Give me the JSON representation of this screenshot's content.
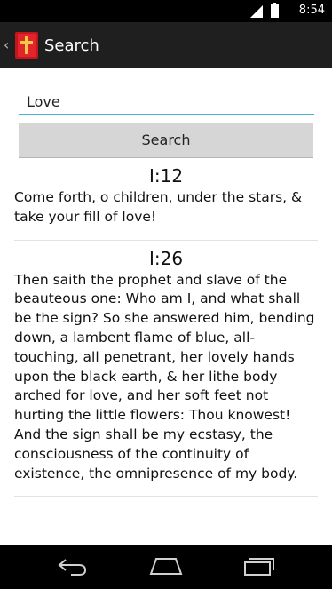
{
  "status_bar": {
    "network": "3G",
    "time": "8:54"
  },
  "action_bar": {
    "title": "Search",
    "icon": "red-book-app-icon"
  },
  "search": {
    "value": "Love",
    "button_label": "Search"
  },
  "results": [
    {
      "reference": "I:12",
      "text": "Come forth, o children, under the stars, & take your fill of love!"
    },
    {
      "reference": "I:26",
      "text": "Then saith the prophet and slave of the beauteous one: Who am I, and what shall be the sign? So she answered him, bending down, a lambent flame of blue, all-touching, all penetrant, her lovely hands upon the black earth, & her lithe body arched for love, and her soft feet not hurting the little flowers: Thou knowest! And the sign shall be my ecstasy, the consciousness of the continuity of existence, the omnipresence of my body."
    }
  ],
  "nav_bar": {
    "back": "back-icon",
    "home": "home-icon",
    "recents": "recents-icon"
  }
}
